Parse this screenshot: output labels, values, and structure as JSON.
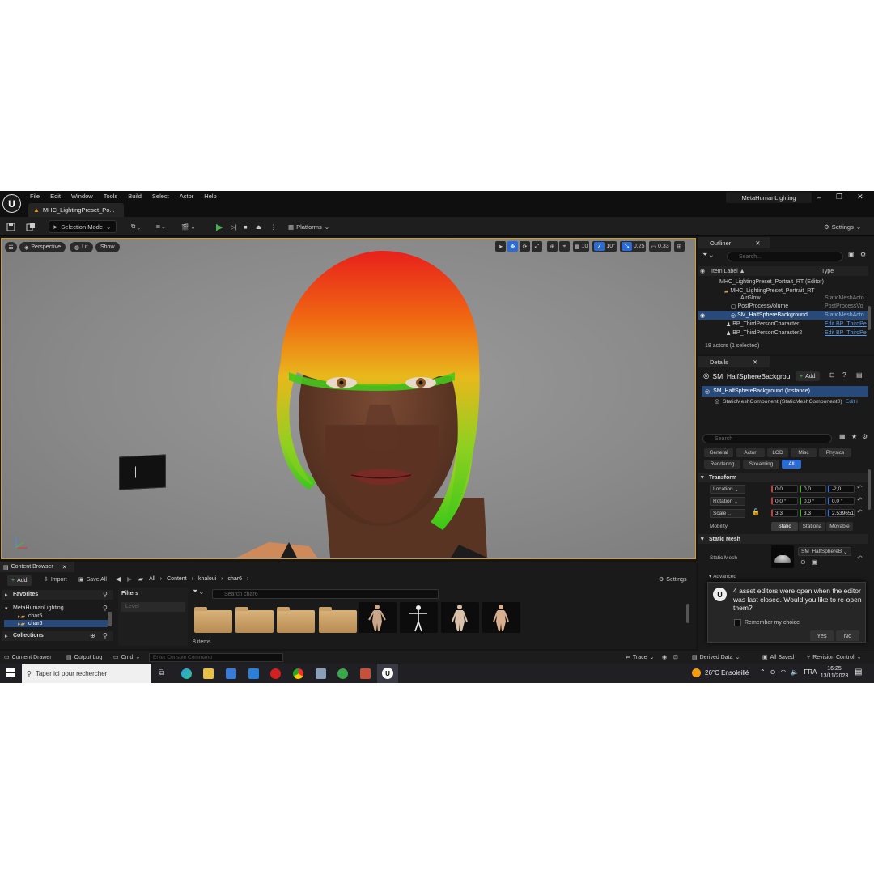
{
  "menubar": {
    "items": [
      "File",
      "Edit",
      "Window",
      "Tools",
      "Build",
      "Select",
      "Actor",
      "Help"
    ],
    "doc_tab": "MHC_LightingPreset_Po...",
    "project_name": "MetaHumanLighting",
    "window_controls": [
      "–",
      "❐",
      "✕"
    ]
  },
  "toolbar": {
    "selection_mode": "Selection Mode",
    "platforms": "Platforms",
    "settings": "Settings"
  },
  "viewport": {
    "perspective": "Perspective",
    "lit": "Lit",
    "show": "Show",
    "grid_snap": "10",
    "rotation_snap": "10°",
    "scale_snap": "0,25",
    "camera_speed": "0,33"
  },
  "outliner": {
    "tab": "Outliner",
    "search_placeholder": "Search...",
    "col_label": "Item Label ▲",
    "col_type": "Type",
    "rows": [
      {
        "label": "MHC_LightingPreset_Portrait_RT (Editor)",
        "type": ""
      },
      {
        "label": "MHC_LightingPreset_Portrait_RT",
        "type": ""
      },
      {
        "label": "AirGlow",
        "type": "StaticMeshActo"
      },
      {
        "label": "PostProcessVolume",
        "type": "PostProcessVo"
      },
      {
        "label": "SM_HalfSphereBackground",
        "type": "StaticMeshActo"
      },
      {
        "label": "BP_ThirdPersonCharacter",
        "type": "Edit BP_ThirdPe"
      },
      {
        "label": "BP_ThirdPersonCharacter2",
        "type": "Edit BP_ThirdPe"
      }
    ],
    "footer": "18 actors (1 selected)"
  },
  "details": {
    "tab": "Details",
    "object_name": "SM_HalfSphereBackgrou",
    "add_label": "Add",
    "instance": "SM_HalfSphereBackground (Instance)",
    "component": "StaticMeshComponent (StaticMeshComponent0)",
    "component_edit": "Edit i",
    "search_placeholder": "Search",
    "filters": [
      "General",
      "Actor",
      "LOD",
      "Misc",
      "Physics",
      "Rendering",
      "Streaming",
      "All"
    ],
    "transform_title": "Transform",
    "location_label": "Location",
    "location": [
      "0,0",
      "0,0",
      "-2,0"
    ],
    "rotation_label": "Rotation",
    "rotation": [
      "0,0 °",
      "0,0 °",
      "0,0 °"
    ],
    "scale_label": "Scale",
    "scale": [
      "3,3",
      "3,3",
      "2,539651"
    ],
    "mobility_label": "Mobility",
    "mobility_options": [
      "Static",
      "Stationa",
      "Movable"
    ],
    "static_mesh_title": "Static Mesh",
    "static_mesh_label": "Static Mesh",
    "static_mesh_value": "SM_HalfSphereB",
    "advanced": "Advanced"
  },
  "dialog": {
    "message": "4 asset editors were open when the editor was last closed. Would you like to re-open them?",
    "remember": "Remember my choice",
    "yes": "Yes",
    "no": "No"
  },
  "content_browser": {
    "tab": "Content Browser",
    "add": "Add",
    "import": "Import",
    "save_all": "Save All",
    "breadcrumb": [
      "All",
      "Content",
      "khaloui",
      "char6"
    ],
    "settings": "Settings",
    "favorites": "Favorites",
    "project": "MetaHumanLighting",
    "folders": [
      "char5",
      "char6"
    ],
    "collections": "Collections",
    "filters_title": "Filters",
    "filter_level": "Level",
    "search_placeholder": "Search char6",
    "item_count": "8 items"
  },
  "statusbar": {
    "content_drawer": "Content Drawer",
    "output_log": "Output Log",
    "cmd": "Cmd",
    "console_placeholder": "Enter Console Command",
    "trace": "Trace",
    "derived_data": "Derived Data",
    "all_saved": "All Saved",
    "revision_control": "Revision Control"
  },
  "taskbar": {
    "search_placeholder": "Taper ici pour rechercher",
    "weather": "26°C  Ensoleillé",
    "lang": "FRA",
    "time": "16:25",
    "date": "13/11/2023"
  },
  "colors": {
    "accent_blue": "#2a6bd4",
    "viewport_border": "#d29a2a",
    "selection": "#274a7a",
    "play_green": "#4caf50"
  }
}
